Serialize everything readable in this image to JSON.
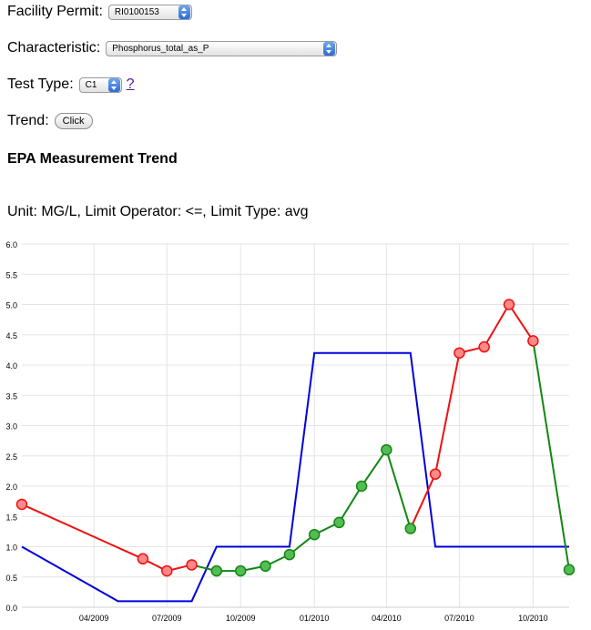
{
  "form": {
    "permit_label": "Facility Permit:",
    "permit_value": "RI0100153",
    "characteristic_label": "Characteristic:",
    "characteristic_value": "Phosphorus_total_as_P",
    "test_type_label": "Test Type:",
    "test_type_value": "C1",
    "help_link": "?",
    "trend_label": "Trend:",
    "trend_button": "Click"
  },
  "heading": "EPA Measurement Trend",
  "unit_text": "Unit: MG/L, Limit Operator: <=, Limit Type: avg",
  "colors": {
    "limit": "#0000dd",
    "exceed": "#ee1111",
    "within": "#118811",
    "exceed_fill": "#ff8888",
    "within_fill": "#55bb55",
    "grid": "#e4e4e4"
  },
  "chart_data": {
    "type": "line",
    "x_ticks": [
      "04/2009",
      "07/2009",
      "10/2009",
      "01/2010",
      "04/2010",
      "07/2010",
      "10/2010"
    ],
    "x_tick_dates": [
      "2009-04-01",
      "2009-07-01",
      "2009-10-01",
      "2010-01-01",
      "2010-04-01",
      "2010-07-01",
      "2010-10-01"
    ],
    "xlim": [
      "2009-01-01",
      "2010-11-15"
    ],
    "ylim": [
      0,
      6
    ],
    "y_ticks": [
      "0.0",
      "0.5",
      "1.0",
      "1.5",
      "2.0",
      "2.5",
      "3.0",
      "3.5",
      "4.0",
      "4.5",
      "5.0",
      "5.5",
      "6.0"
    ],
    "grid": true,
    "series": [
      {
        "role": "limit",
        "x": [
          "2009-01-01",
          "2009-05-01",
          "2009-08-01",
          "2009-09-01",
          "2009-12-01",
          "2010-01-01",
          "2010-05-01",
          "2010-06-01",
          "2010-11-15"
        ],
        "y": [
          1.0,
          0.1,
          0.1,
          1.0,
          1.0,
          4.2,
          4.2,
          1.0,
          1.0
        ]
      },
      {
        "role": "measurement",
        "x": [
          "2009-01-01",
          "2009-06-01",
          "2009-07-01",
          "2009-08-01",
          "2009-09-01",
          "2009-10-01",
          "2009-11-01",
          "2009-12-01",
          "2010-01-01",
          "2010-02-01",
          "2010-03-01",
          "2010-04-01",
          "2010-05-01",
          "2010-06-01",
          "2010-07-01",
          "2010-08-01",
          "2010-09-01",
          "2010-10-01",
          "2010-11-15"
        ],
        "y": [
          1.7,
          0.8,
          0.6,
          0.7,
          0.6,
          0.6,
          0.68,
          0.87,
          1.2,
          1.4,
          2.0,
          2.6,
          1.3,
          2.2,
          4.2,
          4.3,
          5.0,
          4.4,
          0.62
        ]
      }
    ]
  }
}
